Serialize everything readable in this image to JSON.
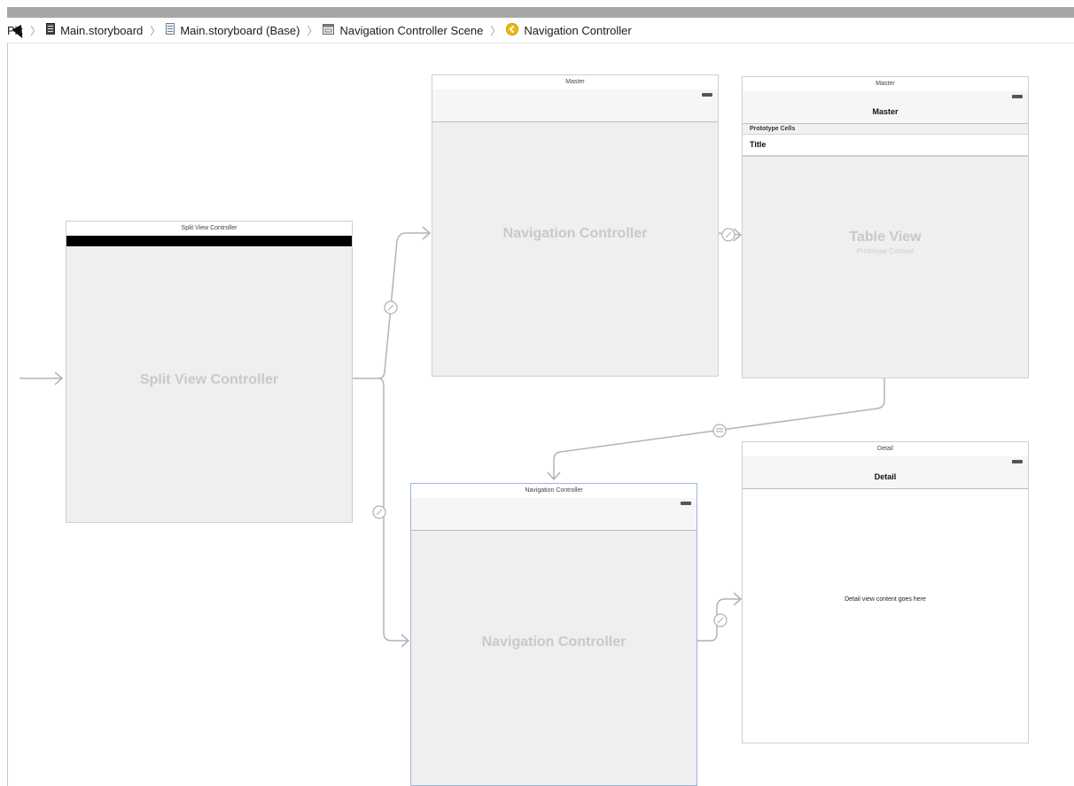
{
  "jumpbar": {
    "items": [
      {
        "label": "Pix",
        "icon": "folder-icon"
      },
      {
        "label": "Main.storyboard",
        "icon": "storyboard-file-icon"
      },
      {
        "label": "Main.storyboard (Base)",
        "icon": "storyboard-file-icon"
      },
      {
        "label": "Navigation Controller Scene",
        "icon": "scene-icon"
      },
      {
        "label": "Navigation Controller",
        "icon": "navigation-controller-icon"
      }
    ]
  },
  "scenes": {
    "split": {
      "title": "Split View Controller",
      "center": "Split View Controller"
    },
    "master_nav": {
      "title": "Master",
      "center": "Navigation Controller"
    },
    "master_table": {
      "title": "Master",
      "nav_title": "Master",
      "section_header": "Prototype Cells",
      "cell_title": "Title",
      "center": "Table View",
      "subcenter": "Prototype Content"
    },
    "detail_nav": {
      "title": "Navigation Controller",
      "center": "Navigation Controller"
    },
    "detail": {
      "title": "Detail",
      "nav_title": "Detail",
      "content": "Detail view content goes here"
    }
  },
  "colors": {
    "accent_yellow": "#f2b817",
    "connector": "#b3b3b3"
  }
}
